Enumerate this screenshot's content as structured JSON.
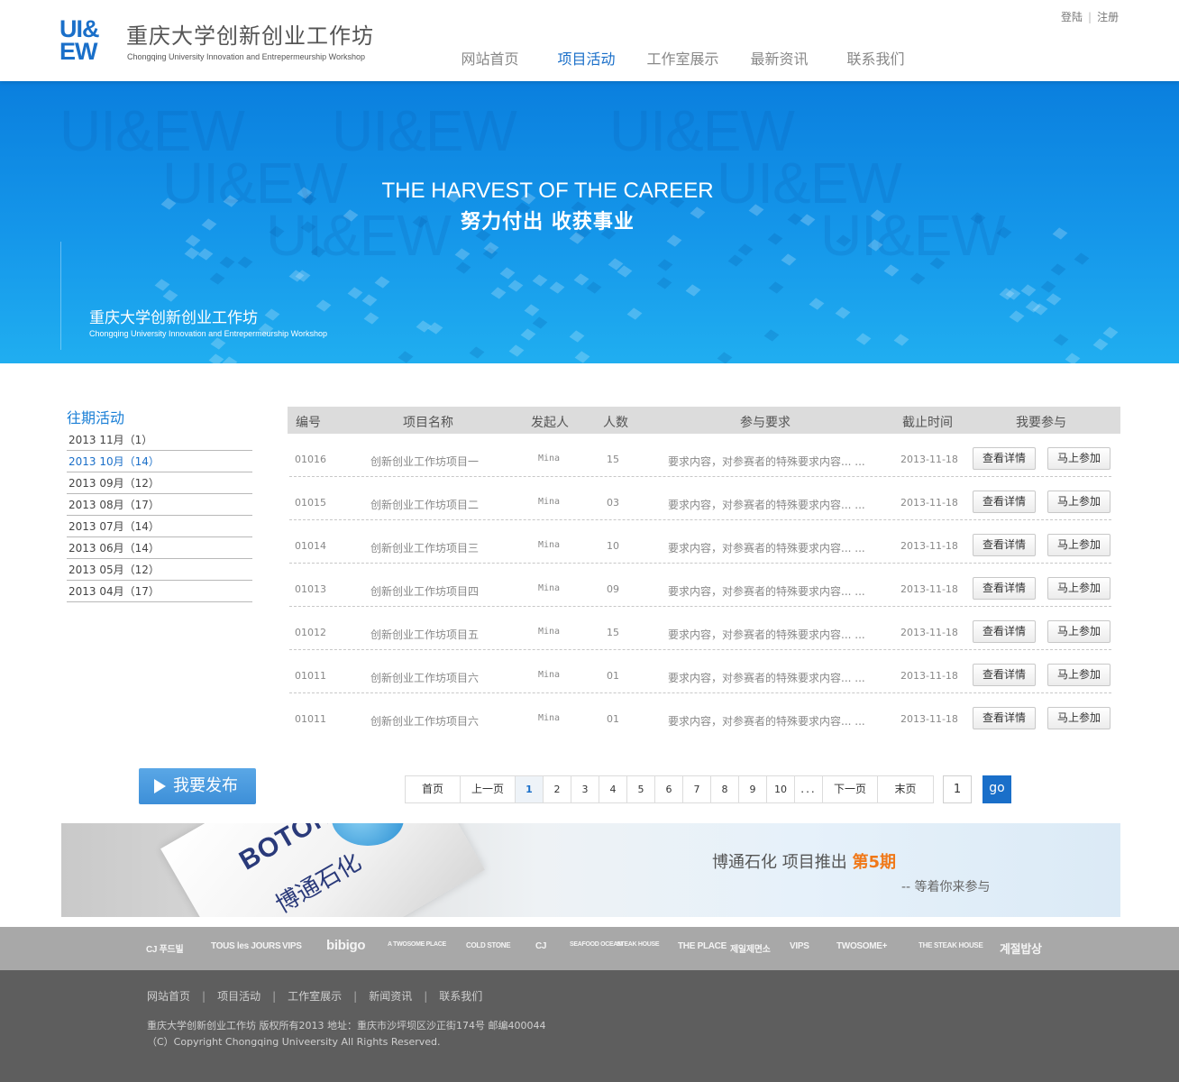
{
  "header": {
    "logo_mark_line1": "UI&",
    "logo_mark_line2": "EW",
    "logo_title": "重庆大学创新创业工作坊",
    "logo_subtitle": "Chongqing University Innovation and Entrepermeurship Workshop",
    "login": "登陆",
    "register": "注册",
    "nav": [
      "网站首页",
      "项目活动",
      "工作室展示",
      "最新资讯",
      "联系我们"
    ],
    "nav_active": "项目活动"
  },
  "banner": {
    "watermark": "UI&EW",
    "headline_en": "THE HARVEST OF THE CAREER",
    "headline_cn": "努力付出 收获事业",
    "brand_cn": "重庆大学创新创业工作坊",
    "brand_en": "Chongqing University Innovation and Entrepermeurship Workshop"
  },
  "sidebar": {
    "title": "往期活动",
    "items": [
      "2013 11月（1）",
      "2013 10月（14）",
      "2013 09月（12）",
      "2013 08月（17）",
      "2013 07月（14）",
      "2013 06月（14）",
      "2013 05月（12）",
      "2013 04月（17）"
    ],
    "active": "2013 10月（14）"
  },
  "table": {
    "headers": [
      "编号",
      "项目名称",
      "发起人",
      "人数",
      "参与要求",
      "截止时间",
      "我要参与"
    ],
    "detail_label": "查看详情",
    "join_label": "马上参加",
    "rows": [
      {
        "id": "01016",
        "name": "创新创业工作坊项目一",
        "user": "Mina",
        "count": "15",
        "req": "要求内容，对参赛者的特殊要求内容... ...",
        "date": "2013-11-18"
      },
      {
        "id": "01015",
        "name": "创新创业工作坊项目二",
        "user": "Mina",
        "count": "03",
        "req": "要求内容，对参赛者的特殊要求内容... ...",
        "date": "2013-11-18"
      },
      {
        "id": "01014",
        "name": "创新创业工作坊项目三",
        "user": "Mina",
        "count": "10",
        "req": "要求内容，对参赛者的特殊要求内容... ...",
        "date": "2013-11-18"
      },
      {
        "id": "01013",
        "name": "创新创业工作坊项目四",
        "user": "Mina",
        "count": "09",
        "req": "要求内容，对参赛者的特殊要求内容... ...",
        "date": "2013-11-18"
      },
      {
        "id": "01012",
        "name": "创新创业工作坊项目五",
        "user": "Mina",
        "count": "15",
        "req": "要求内容，对参赛者的特殊要求内容... ...",
        "date": "2013-11-18"
      },
      {
        "id": "01011",
        "name": "创新创业工作坊项目六",
        "user": "Mina",
        "count": "01",
        "req": "要求内容，对参赛者的特殊要求内容... ...",
        "date": "2013-11-18"
      },
      {
        "id": "01011",
        "name": "创新创业工作坊项目六",
        "user": "Mina",
        "count": "01",
        "req": "要求内容，对参赛者的特殊要求内容... ...",
        "date": "2013-11-18"
      }
    ]
  },
  "publish_label": "我要发布",
  "pager": {
    "first": "首页",
    "prev": "上一页",
    "pages": [
      "1",
      "2",
      "3",
      "4",
      "5",
      "6",
      "7",
      "8",
      "9",
      "10"
    ],
    "current": "1",
    "ellipsis": "...",
    "next": "下一页",
    "last": "末页",
    "input_value": "1",
    "go": "go"
  },
  "ad": {
    "logo": "BOTONE",
    "logo_cn": "博通石化",
    "title": "博通石化  项目推出",
    "highlight": "第5期",
    "subtitle": "-- 等着你来参与"
  },
  "brands": [
    "CJ 푸드빌",
    "TOUS les JOURS",
    "VIPS",
    "bibigo",
    "A TWOSOME PLACE",
    "COLD STONE",
    "CJ",
    "SEAFOOD OCEAN",
    "STEAK HOUSE",
    "THE PLACE",
    "제일제면소",
    "VIPS",
    "TWOSOME+",
    "THE STEAK HOUSE",
    "계절밥상"
  ],
  "footer": {
    "links": [
      "网站首页",
      "项目活动",
      "工作室展示",
      "新闻资讯",
      "联系我们"
    ],
    "copyright": "重庆大学创新创业工作坊 版权所有2013   地址：重庆市沙坪坝区沙正街174号   邮编400044",
    "copyright_en": "（C）Copyright Chongqing Univeersity All Rights Reserved."
  }
}
